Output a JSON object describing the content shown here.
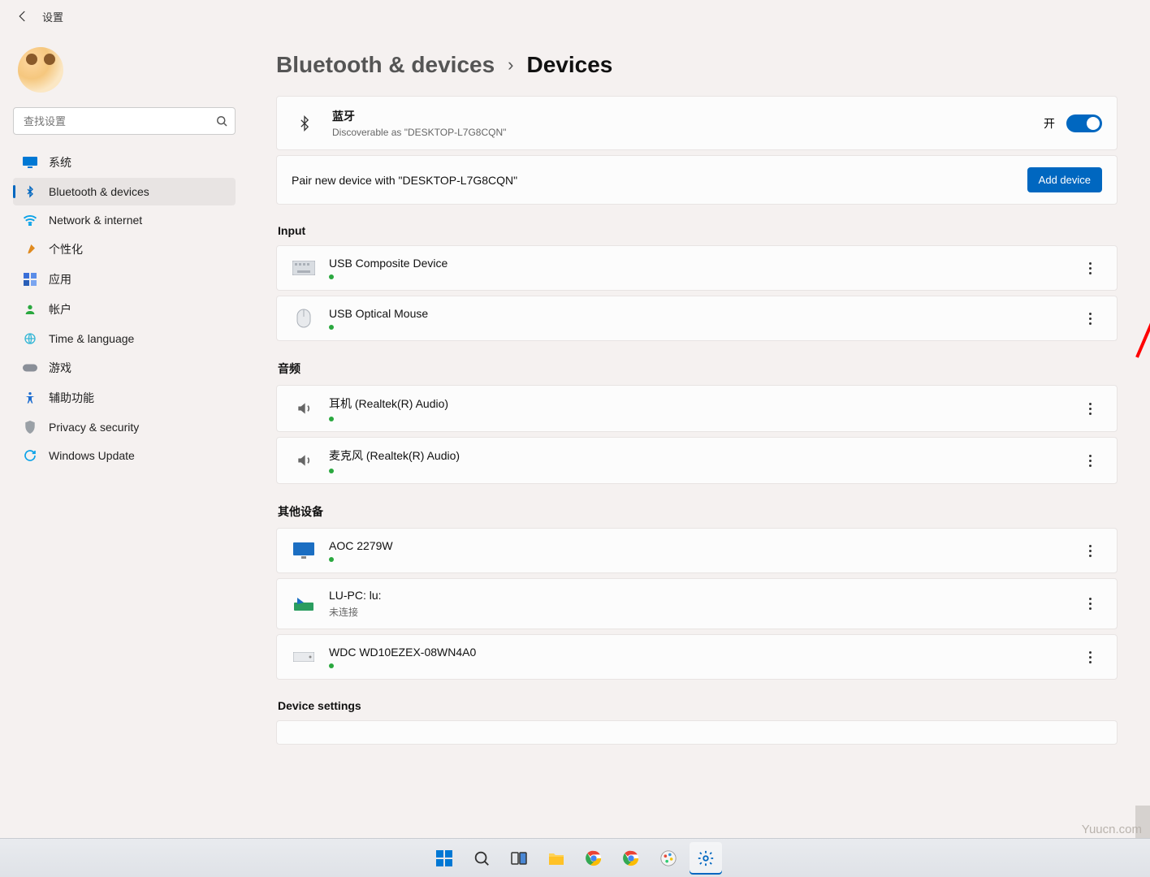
{
  "header": {
    "back_aria": "back",
    "title": "设置"
  },
  "search": {
    "placeholder": "查找设置"
  },
  "sidebar": {
    "items": [
      {
        "icon": "monitor",
        "label": "系统",
        "color": "#0078d4"
      },
      {
        "icon": "bluetooth",
        "label": "Bluetooth & devices",
        "color": "#0067c0",
        "active": true
      },
      {
        "icon": "wifi",
        "label": "Network & internet",
        "color": "#0aa2e8"
      },
      {
        "icon": "brush",
        "label": "个性化",
        "color": "#e08a1e"
      },
      {
        "icon": "apps",
        "label": "应用",
        "color": "#3a6fd8"
      },
      {
        "icon": "person",
        "label": "帐户",
        "color": "#2aa83f"
      },
      {
        "icon": "globe",
        "label": "Time & language",
        "color": "#35b7d6"
      },
      {
        "icon": "gamepad",
        "label": "游戏",
        "color": "#8a8f98"
      },
      {
        "icon": "access",
        "label": "辅助功能",
        "color": "#1c6dd0"
      },
      {
        "icon": "shield",
        "label": "Privacy & security",
        "color": "#9aa0a6"
      },
      {
        "icon": "update",
        "label": "Windows Update",
        "color": "#0aa2e8"
      }
    ]
  },
  "breadcrumb": {
    "parent": "Bluetooth & devices",
    "current": "Devices"
  },
  "bluetooth": {
    "title": "蓝牙",
    "subtext": "Discoverable as \"DESKTOP-L7G8CQN\"",
    "state_label": "开",
    "on": true
  },
  "pair": {
    "text": "Pair new device with \"DESKTOP-L7G8CQN\"",
    "add_label": "Add device"
  },
  "sections": {
    "input_title": "Input",
    "audio_title": "音频",
    "other_title": "其他设备",
    "settings_title": "Device settings"
  },
  "devices": {
    "input": [
      {
        "name": "USB Composite Device",
        "icon": "keyboard",
        "connected": true
      },
      {
        "name": "USB Optical Mouse",
        "icon": "mouse",
        "connected": true
      }
    ],
    "audio": [
      {
        "name": "耳机 (Realtek(R) Audio)",
        "icon": "speaker",
        "connected": true
      },
      {
        "name": "麦克风 (Realtek(R) Audio)",
        "icon": "mic",
        "connected": true
      }
    ],
    "other": [
      {
        "name": "AOC 2279W",
        "icon": "display",
        "connected": true
      },
      {
        "name": "LU-PC: lu:",
        "icon": "media",
        "sub": "未连接"
      },
      {
        "name": "WDC WD10EZEX-08WN4A0",
        "icon": "drive",
        "connected": true
      }
    ]
  },
  "watermark": "Yuucn.com",
  "taskbar": {
    "items": [
      {
        "name": "start"
      },
      {
        "name": "search"
      },
      {
        "name": "taskview"
      },
      {
        "name": "explorer"
      },
      {
        "name": "chrome1"
      },
      {
        "name": "chrome2"
      },
      {
        "name": "paint"
      },
      {
        "name": "settings",
        "active": true
      }
    ]
  },
  "colors": {
    "accent": "#0067c0",
    "green": "#2aa83f"
  }
}
